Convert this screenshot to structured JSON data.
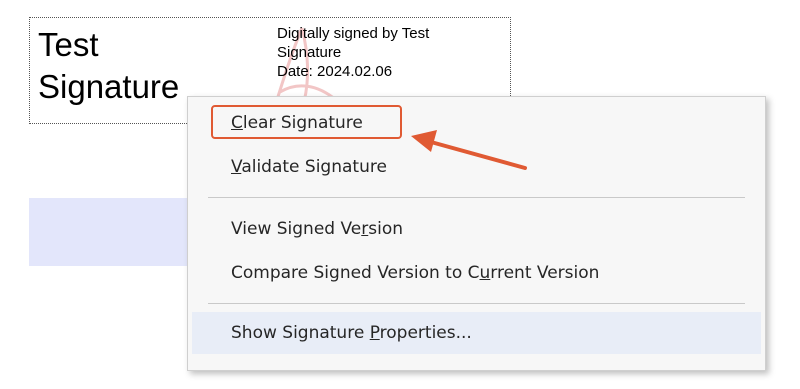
{
  "signature": {
    "name_line1": "Test",
    "name_line2": "Signature",
    "details": [
      "Digitally signed by Test",
      "Signature",
      "Date: 2024.02.06"
    ]
  },
  "context_menu": {
    "clear": {
      "pre": "",
      "key": "C",
      "post": "lear Signature"
    },
    "validate": {
      "pre": "",
      "key": "V",
      "post": "alidate Signature"
    },
    "view": {
      "pre": "View Signed Ve",
      "key": "r",
      "post": "sion"
    },
    "compare": {
      "pre": "Compare Signed Version to C",
      "key": "u",
      "post": "rrent Version"
    },
    "properties": {
      "pre": "Show Signature ",
      "key": "P",
      "post": "roperties..."
    }
  },
  "colors": {
    "annotation": "#e05a33",
    "hover": "#e8edf7",
    "band": "#e3e6fb"
  }
}
